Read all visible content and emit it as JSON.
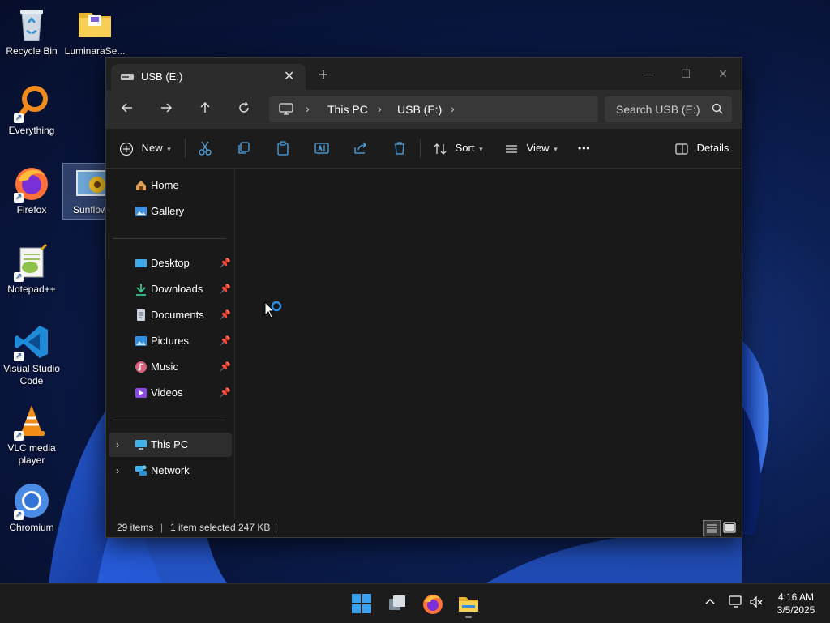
{
  "desktop": {
    "icons": [
      {
        "label": "Recycle Bin"
      },
      {
        "label": "LuminaraSe..."
      },
      {
        "label": "Everything"
      },
      {
        "label": "Firefox"
      },
      {
        "label": "Sunflow"
      },
      {
        "label": "Notepad++"
      },
      {
        "label": "Visual Studio Code"
      },
      {
        "label": "VLC media player"
      },
      {
        "label": "Chromium"
      }
    ]
  },
  "window": {
    "tab_title": "USB (E:)",
    "tab_close": "✕",
    "new_tab": "+",
    "controls": {
      "minimize": "—",
      "maximize": "☐",
      "close": "✕"
    },
    "breadcrumb": [
      "This PC",
      "USB (E:)"
    ],
    "search_placeholder": "Search USB (E:)",
    "toolbar": {
      "new_label": "New",
      "sort_label": "Sort",
      "view_label": "View",
      "more_label": "•••",
      "details_label": "Details"
    },
    "sidebar": {
      "top": [
        {
          "label": "Home"
        },
        {
          "label": "Gallery"
        }
      ],
      "pinned": [
        {
          "label": "Desktop"
        },
        {
          "label": "Downloads"
        },
        {
          "label": "Documents"
        },
        {
          "label": "Pictures"
        },
        {
          "label": "Music"
        },
        {
          "label": "Videos"
        }
      ],
      "tree": [
        {
          "label": "This PC"
        },
        {
          "label": "Network"
        }
      ]
    },
    "status": {
      "items": "29 items",
      "selected": "1 item selected",
      "size": "247 KB"
    }
  },
  "taskbar": {
    "time": "4:16 AM",
    "date": "3/5/2025"
  },
  "colors": {
    "accent": "#0078d4",
    "window_bg": "#191919",
    "toolbar_bg": "#1c1c1c",
    "taskbar_bg": "#1c1c1c"
  }
}
